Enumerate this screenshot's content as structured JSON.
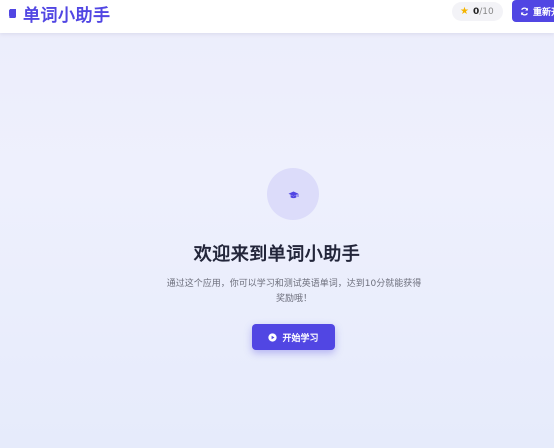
{
  "header": {
    "app_title": "单词小助手",
    "brand_icon": "book-icon",
    "score": {
      "icon": "star-icon",
      "value": "0",
      "total": "/10"
    },
    "refresh_button": {
      "icon": "refresh-icon",
      "label": "重新开始"
    }
  },
  "main": {
    "hero_icon": "graduation-cap-icon",
    "welcome_title": "欢迎来到单词小助手",
    "description": "通过这个应用，你可以学习和测试英语单词，达到10分就能获得奖励哦！",
    "start_button": {
      "icon": "play-circle-icon",
      "label": "开始学习"
    }
  },
  "colors": {
    "accent": "#5146e3",
    "star": "#f4b400",
    "title_text": "#23263a",
    "body_text": "#6d6f7c"
  }
}
